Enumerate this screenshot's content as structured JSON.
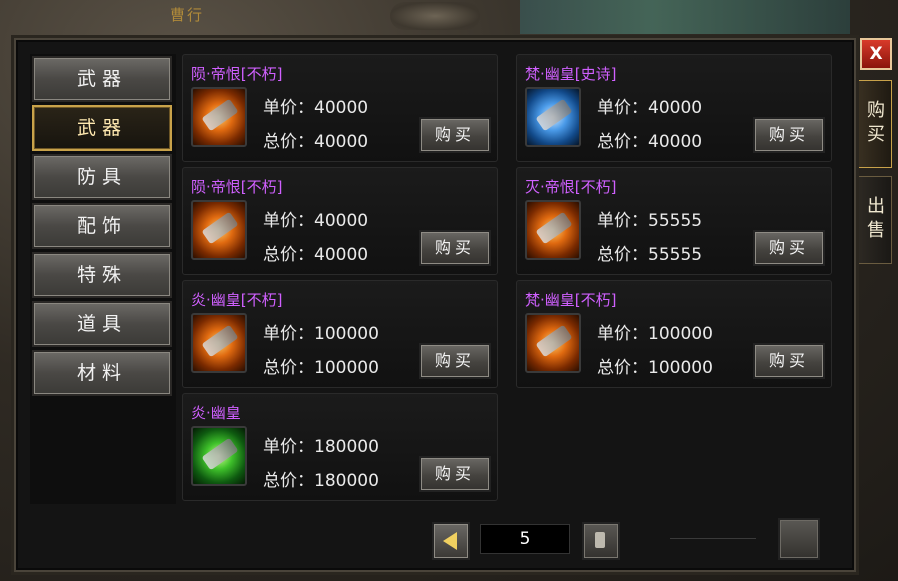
{
  "header": {
    "title_fragment": "曹行"
  },
  "window": {
    "close_label": "X"
  },
  "side_tabs": [
    {
      "label": "购买",
      "active": true
    },
    {
      "label": "出售",
      "active": false
    }
  ],
  "categories": [
    {
      "label": "武器",
      "active": false
    },
    {
      "label": "武器",
      "active": true
    },
    {
      "label": "防具",
      "active": false
    },
    {
      "label": "配饰",
      "active": false
    },
    {
      "label": "特殊",
      "active": false
    },
    {
      "label": "道具",
      "active": false
    },
    {
      "label": "材料",
      "active": false
    }
  ],
  "listings": [
    {
      "name": "陨·帝恨[不朽]",
      "unit": "单价：40000",
      "total": "总价：40000",
      "icon": "orange-weapon-icon",
      "buy": "购买"
    },
    {
      "name": "梵·幽皇[史诗]",
      "unit": "单价：40000",
      "total": "总价：40000",
      "icon": "blue-weapon-icon",
      "buy": "购买"
    },
    {
      "name": "陨·帝恨[不朽]",
      "unit": "单价：40000",
      "total": "总价：40000",
      "icon": "orange-weapon-icon",
      "buy": "购买"
    },
    {
      "name": "灭·帝恨[不朽]",
      "unit": "单价：55555",
      "total": "总价：55555",
      "icon": "orange-weapon-icon",
      "buy": "购买"
    },
    {
      "name": "炎·幽皇[不朽]",
      "unit": "单价：100000",
      "total": "总价：100000",
      "icon": "orange-weapon-icon",
      "buy": "购买"
    },
    {
      "name": "梵·幽皇[不朽]",
      "unit": "单价：100000",
      "total": "总价：100000",
      "icon": "orange-weapon-icon",
      "buy": "购买"
    },
    {
      "name": "炎·幽皇",
      "unit": "单价：180000",
      "total": "总价：180000",
      "icon": "green-weapon-icon",
      "buy": "购买"
    }
  ],
  "pagination": {
    "page": "5"
  },
  "colors": {
    "item_name": "#d060ff",
    "active_border": "#c8a24a",
    "close_red": "#d83a2a"
  }
}
